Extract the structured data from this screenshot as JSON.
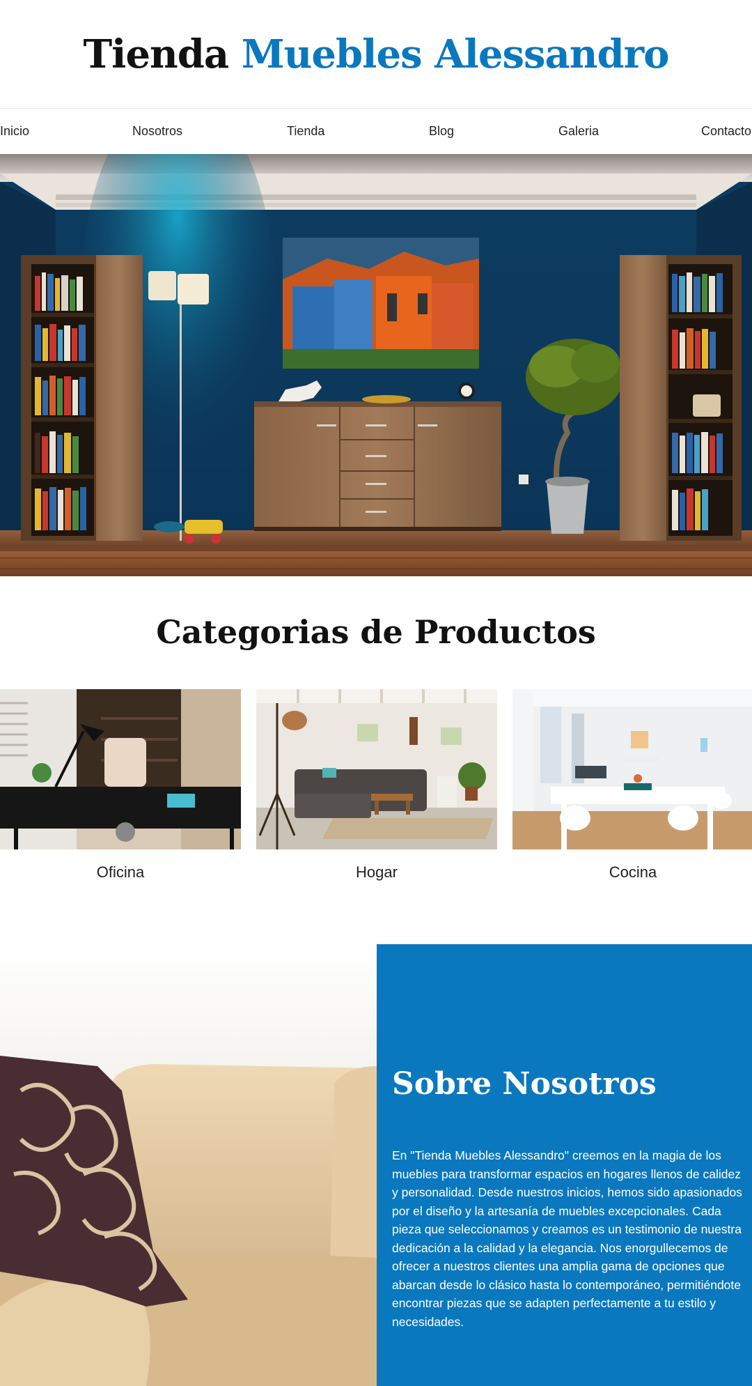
{
  "brand": {
    "part1": "Tienda",
    "part2": "Muebles Alessandro",
    "accent_color": "#0a78be"
  },
  "nav": {
    "items": [
      {
        "label": "Inicio"
      },
      {
        "label": "Nosotros"
      },
      {
        "label": "Tienda"
      },
      {
        "label": "Blog"
      },
      {
        "label": "Galeria"
      },
      {
        "label": "Contacto"
      }
    ]
  },
  "categories": {
    "title": "Categorias de Productos",
    "items": [
      {
        "label": "Oficina"
      },
      {
        "label": "Hogar"
      },
      {
        "label": "Cocina"
      }
    ]
  },
  "about": {
    "title": "Sobre Nosotros",
    "text": "En \"Tienda Muebles Alessandro\" creemos en la magia de los muebles para transformar espacios en hogares llenos de calidez y personalidad. Desde nuestros inicios, hemos sido apasionados por el diseño y la artesanía de muebles excepcionales. Cada pieza que seleccionamos y creamos es un testimonio de nuestra dedicación a la calidad y la elegancia. Nos enorgullecemos de ofrecer a nuestros clientes una amplia gama de opciones que abarcan desde lo clásico hasta lo contemporáneo, permitiéndote encontrar piezas que se adapten perfectamente a tu estilo y necesidades.",
    "panel_color": "#0a78be"
  }
}
